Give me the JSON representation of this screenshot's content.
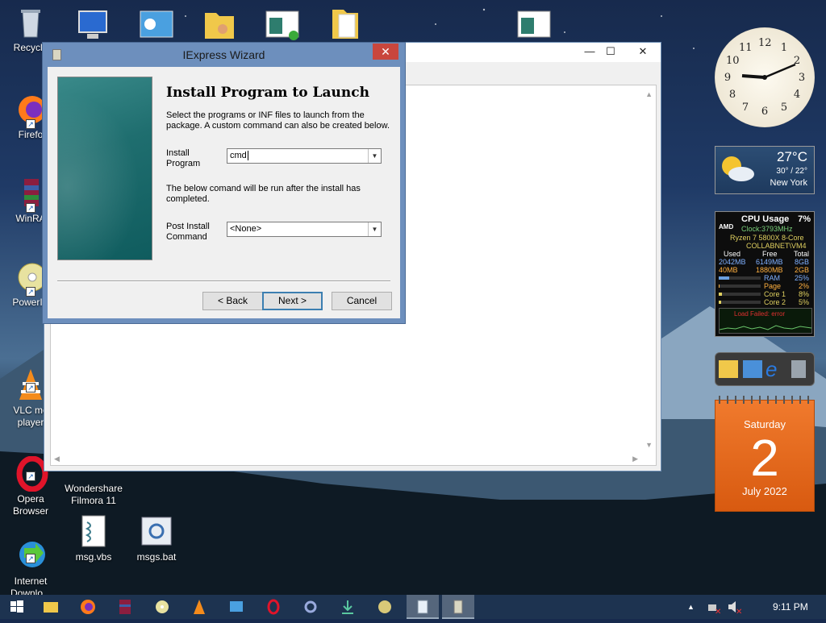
{
  "desktop": {
    "icons": [
      {
        "label": "Recycle",
        "icon": "recycle-bin-icon"
      },
      {
        "label": "Firefo",
        "icon": "firefox-icon"
      },
      {
        "label": "WinRA",
        "icon": "winrar-icon"
      },
      {
        "label": "PowerIS",
        "icon": "poweriso-icon"
      },
      {
        "label": "VLC me\nplayer",
        "icon": "vlc-icon"
      },
      {
        "label": "Opera\nBrowser",
        "icon": "opera-icon"
      },
      {
        "label": "Wondershare\nFilmora 11",
        "icon": "filmora-icon"
      },
      {
        "label": "Internet\nDownlo...",
        "icon": "idm-icon"
      },
      {
        "label": "msg.vbs",
        "icon": "vbs-script-icon"
      },
      {
        "label": "msgs.bat",
        "icon": "bat-file-icon"
      }
    ]
  },
  "background_window": {
    "minimize": "—",
    "maximize": "☐",
    "close": "✕"
  },
  "wizard": {
    "title": "IExpress Wizard",
    "close": "✕",
    "heading": "Install Program to Launch",
    "description": "Select the programs or INF files to launch from the package.  A custom command can also be created below.",
    "install_label": "Install\nProgram",
    "install_value": "cmd",
    "note": "The below comand will be run after the install has completed.",
    "post_label": "Post Install\nCommand",
    "post_value": "<None>",
    "back": "< Back",
    "next": "Next >",
    "cancel": "Cancel"
  },
  "gadgets": {
    "clock_numbers": [
      "12",
      "1",
      "2",
      "3",
      "4",
      "5",
      "6",
      "7",
      "8",
      "9",
      "10",
      "11"
    ],
    "weather": {
      "temp": "27°C",
      "range": "30° / 22°",
      "city": "New York"
    },
    "cpu": {
      "title": "CPU Usage",
      "percent": "7%",
      "brand": "AMD",
      "clock": "Clock:3793MHz",
      "model": "Ryzen 7 5800X 8-Core",
      "host": "COLLABNET\\VM4",
      "headers": [
        "Used",
        "Free",
        "Total"
      ],
      "row1": [
        "2042MB",
        "6149MB",
        "8GB"
      ],
      "row2": [
        "40MB",
        "1880MB",
        "2GB"
      ],
      "meters": [
        {
          "label": "RAM",
          "value": "25%"
        },
        {
          "label": "Page",
          "value": "2%"
        },
        {
          "label": "Core 1",
          "value": "8%"
        },
        {
          "label": "Core 2",
          "value": "5%"
        }
      ],
      "error": "Load Failed: error"
    },
    "calendar": {
      "weekday": "Saturday",
      "day": "2",
      "month_year": "July 2022"
    }
  },
  "taskbar": {
    "time": "9:11 PM",
    "tray_up": "▲"
  }
}
